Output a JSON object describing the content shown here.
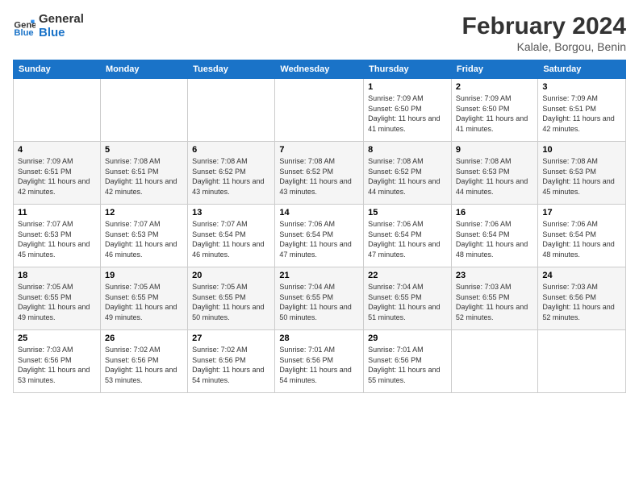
{
  "logo": {
    "line1": "General",
    "line2": "Blue"
  },
  "title": "February 2024",
  "subtitle": "Kalale, Borgou, Benin",
  "headers": [
    "Sunday",
    "Monday",
    "Tuesday",
    "Wednesday",
    "Thursday",
    "Friday",
    "Saturday"
  ],
  "weeks": [
    [
      {
        "day": "",
        "info": ""
      },
      {
        "day": "",
        "info": ""
      },
      {
        "day": "",
        "info": ""
      },
      {
        "day": "",
        "info": ""
      },
      {
        "day": "1",
        "info": "Sunrise: 7:09 AM\nSunset: 6:50 PM\nDaylight: 11 hours and 41 minutes."
      },
      {
        "day": "2",
        "info": "Sunrise: 7:09 AM\nSunset: 6:50 PM\nDaylight: 11 hours and 41 minutes."
      },
      {
        "day": "3",
        "info": "Sunrise: 7:09 AM\nSunset: 6:51 PM\nDaylight: 11 hours and 42 minutes."
      }
    ],
    [
      {
        "day": "4",
        "info": "Sunrise: 7:09 AM\nSunset: 6:51 PM\nDaylight: 11 hours and 42 minutes."
      },
      {
        "day": "5",
        "info": "Sunrise: 7:08 AM\nSunset: 6:51 PM\nDaylight: 11 hours and 42 minutes."
      },
      {
        "day": "6",
        "info": "Sunrise: 7:08 AM\nSunset: 6:52 PM\nDaylight: 11 hours and 43 minutes."
      },
      {
        "day": "7",
        "info": "Sunrise: 7:08 AM\nSunset: 6:52 PM\nDaylight: 11 hours and 43 minutes."
      },
      {
        "day": "8",
        "info": "Sunrise: 7:08 AM\nSunset: 6:52 PM\nDaylight: 11 hours and 44 minutes."
      },
      {
        "day": "9",
        "info": "Sunrise: 7:08 AM\nSunset: 6:53 PM\nDaylight: 11 hours and 44 minutes."
      },
      {
        "day": "10",
        "info": "Sunrise: 7:08 AM\nSunset: 6:53 PM\nDaylight: 11 hours and 45 minutes."
      }
    ],
    [
      {
        "day": "11",
        "info": "Sunrise: 7:07 AM\nSunset: 6:53 PM\nDaylight: 11 hours and 45 minutes."
      },
      {
        "day": "12",
        "info": "Sunrise: 7:07 AM\nSunset: 6:53 PM\nDaylight: 11 hours and 46 minutes."
      },
      {
        "day": "13",
        "info": "Sunrise: 7:07 AM\nSunset: 6:54 PM\nDaylight: 11 hours and 46 minutes."
      },
      {
        "day": "14",
        "info": "Sunrise: 7:06 AM\nSunset: 6:54 PM\nDaylight: 11 hours and 47 minutes."
      },
      {
        "day": "15",
        "info": "Sunrise: 7:06 AM\nSunset: 6:54 PM\nDaylight: 11 hours and 47 minutes."
      },
      {
        "day": "16",
        "info": "Sunrise: 7:06 AM\nSunset: 6:54 PM\nDaylight: 11 hours and 48 minutes."
      },
      {
        "day": "17",
        "info": "Sunrise: 7:06 AM\nSunset: 6:54 PM\nDaylight: 11 hours and 48 minutes."
      }
    ],
    [
      {
        "day": "18",
        "info": "Sunrise: 7:05 AM\nSunset: 6:55 PM\nDaylight: 11 hours and 49 minutes."
      },
      {
        "day": "19",
        "info": "Sunrise: 7:05 AM\nSunset: 6:55 PM\nDaylight: 11 hours and 49 minutes."
      },
      {
        "day": "20",
        "info": "Sunrise: 7:05 AM\nSunset: 6:55 PM\nDaylight: 11 hours and 50 minutes."
      },
      {
        "day": "21",
        "info": "Sunrise: 7:04 AM\nSunset: 6:55 PM\nDaylight: 11 hours and 50 minutes."
      },
      {
        "day": "22",
        "info": "Sunrise: 7:04 AM\nSunset: 6:55 PM\nDaylight: 11 hours and 51 minutes."
      },
      {
        "day": "23",
        "info": "Sunrise: 7:03 AM\nSunset: 6:55 PM\nDaylight: 11 hours and 52 minutes."
      },
      {
        "day": "24",
        "info": "Sunrise: 7:03 AM\nSunset: 6:56 PM\nDaylight: 11 hours and 52 minutes."
      }
    ],
    [
      {
        "day": "25",
        "info": "Sunrise: 7:03 AM\nSunset: 6:56 PM\nDaylight: 11 hours and 53 minutes."
      },
      {
        "day": "26",
        "info": "Sunrise: 7:02 AM\nSunset: 6:56 PM\nDaylight: 11 hours and 53 minutes."
      },
      {
        "day": "27",
        "info": "Sunrise: 7:02 AM\nSunset: 6:56 PM\nDaylight: 11 hours and 54 minutes."
      },
      {
        "day": "28",
        "info": "Sunrise: 7:01 AM\nSunset: 6:56 PM\nDaylight: 11 hours and 54 minutes."
      },
      {
        "day": "29",
        "info": "Sunrise: 7:01 AM\nSunset: 6:56 PM\nDaylight: 11 hours and 55 minutes."
      },
      {
        "day": "",
        "info": ""
      },
      {
        "day": "",
        "info": ""
      }
    ]
  ]
}
